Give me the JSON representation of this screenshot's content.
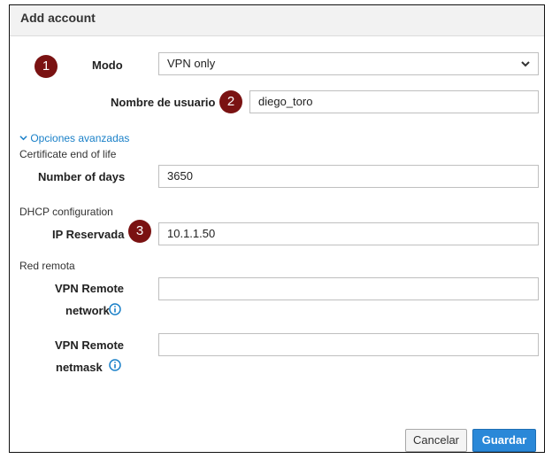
{
  "dialog": {
    "title": "Add account",
    "mode": {
      "label": "Modo",
      "value": "VPN only",
      "badge": "1"
    },
    "username": {
      "label": "Nombre de usuario",
      "value": "diego_toro",
      "badge": "2"
    },
    "advanced_toggle": "Opciones avanzadas",
    "certificate_section": "Certificate end of life",
    "days": {
      "label": "Number of days",
      "value": "3650"
    },
    "dhcp_section": "DHCP configuration",
    "reserved_ip": {
      "label": "IP Reservada",
      "value": "10.1.1.50",
      "badge": "3"
    },
    "remote_section": "Red remota",
    "remote_network": {
      "label_line1": "VPN Remote",
      "label_line2": "network",
      "value": ""
    },
    "remote_netmask": {
      "label_line1": "VPN Remote",
      "label_line2": "netmask",
      "value": ""
    },
    "buttons": {
      "cancel": "Cancelar",
      "save": "Guardar"
    }
  },
  "colors": {
    "badge": "#7a1212",
    "accent": "#2a88d8",
    "link": "#1a80c8"
  },
  "icons": {
    "chevron": "chevron-down-icon",
    "info": "info-icon"
  }
}
